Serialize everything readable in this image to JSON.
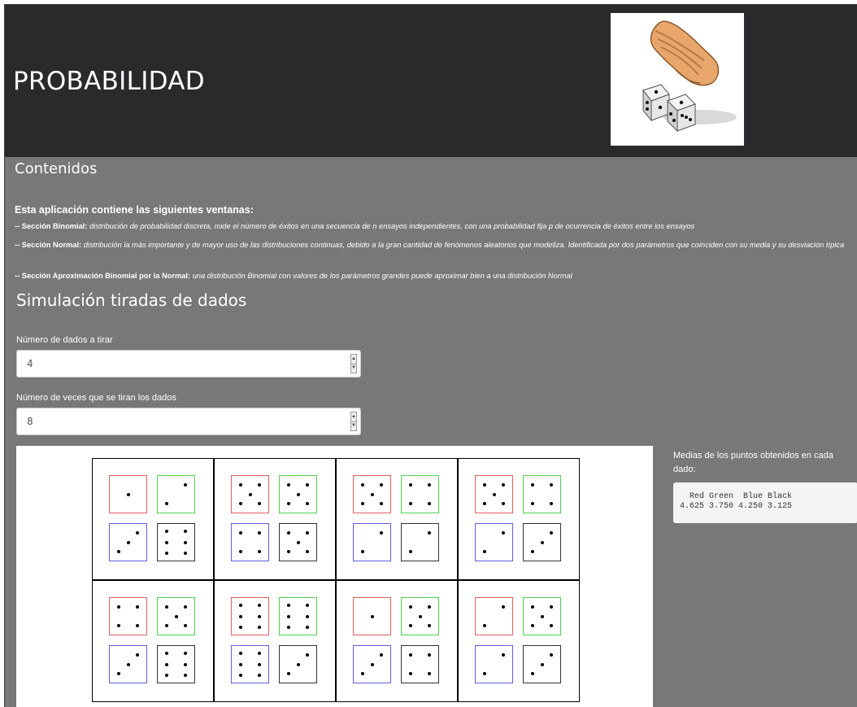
{
  "header": {
    "title": "PROBABILIDAD"
  },
  "logo": {
    "icon": "hand-throwing-dice-icon",
    "description_visible_text": ""
  },
  "contenidos": {
    "title": "Contenidos",
    "intro": "Esta aplicación contiene las siguientes ventanas:",
    "sections": [
      {
        "name": "-- Sección Binomial:",
        "desc": "distribución de probabilidad discreta, mide el número de éxitos en una secuencia de n ensayos independientes, con una probabilidad fija p de ocurrencia de éxitos entre los ensayos"
      },
      {
        "name": "-- Sección Normal:",
        "desc": "distribución la más importante y de mayor uso de las distribuciones continuas, debido a la gran cantidad de fenómenos aleatorios que modeliza. Identificada por dos parámetros que coinciden con su media y su desviación típica"
      },
      {
        "name": "-- Sección Aproximación Binomial por la Normal:",
        "desc": "una distribución Binomial con valores de los parámetros grandes puede aproximar bien a una distribución Normal"
      }
    ]
  },
  "simulacion": {
    "title": "Simulación tiradas de dados",
    "dice_label": "Número de dados a tirar",
    "dice_value": "4",
    "rolls_label": "Número de veces que se tiran los dados",
    "rolls_value": "8",
    "means_label": "Medias de los puntos obtenidos en cada dado:",
    "means_header": "  Red Green  Blue Black",
    "means_values": "4.625 3.750 4.250 3.125"
  },
  "colors": {
    "header_bg": "#2a2a2d",
    "body_bg": "#787878",
    "red": "#e06060",
    "green": "#4fd04f",
    "blue": "#6060e0",
    "black": "#333333"
  },
  "rolls": [
    [
      1,
      2,
      3,
      6
    ],
    [
      5,
      5,
      4,
      5
    ],
    [
      5,
      4,
      2,
      2
    ],
    [
      5,
      4,
      2,
      3
    ],
    [
      4,
      5,
      3,
      6
    ],
    [
      6,
      6,
      6,
      3
    ],
    [
      1,
      5,
      3,
      4
    ],
    [
      2,
      5,
      2,
      3
    ]
  ]
}
